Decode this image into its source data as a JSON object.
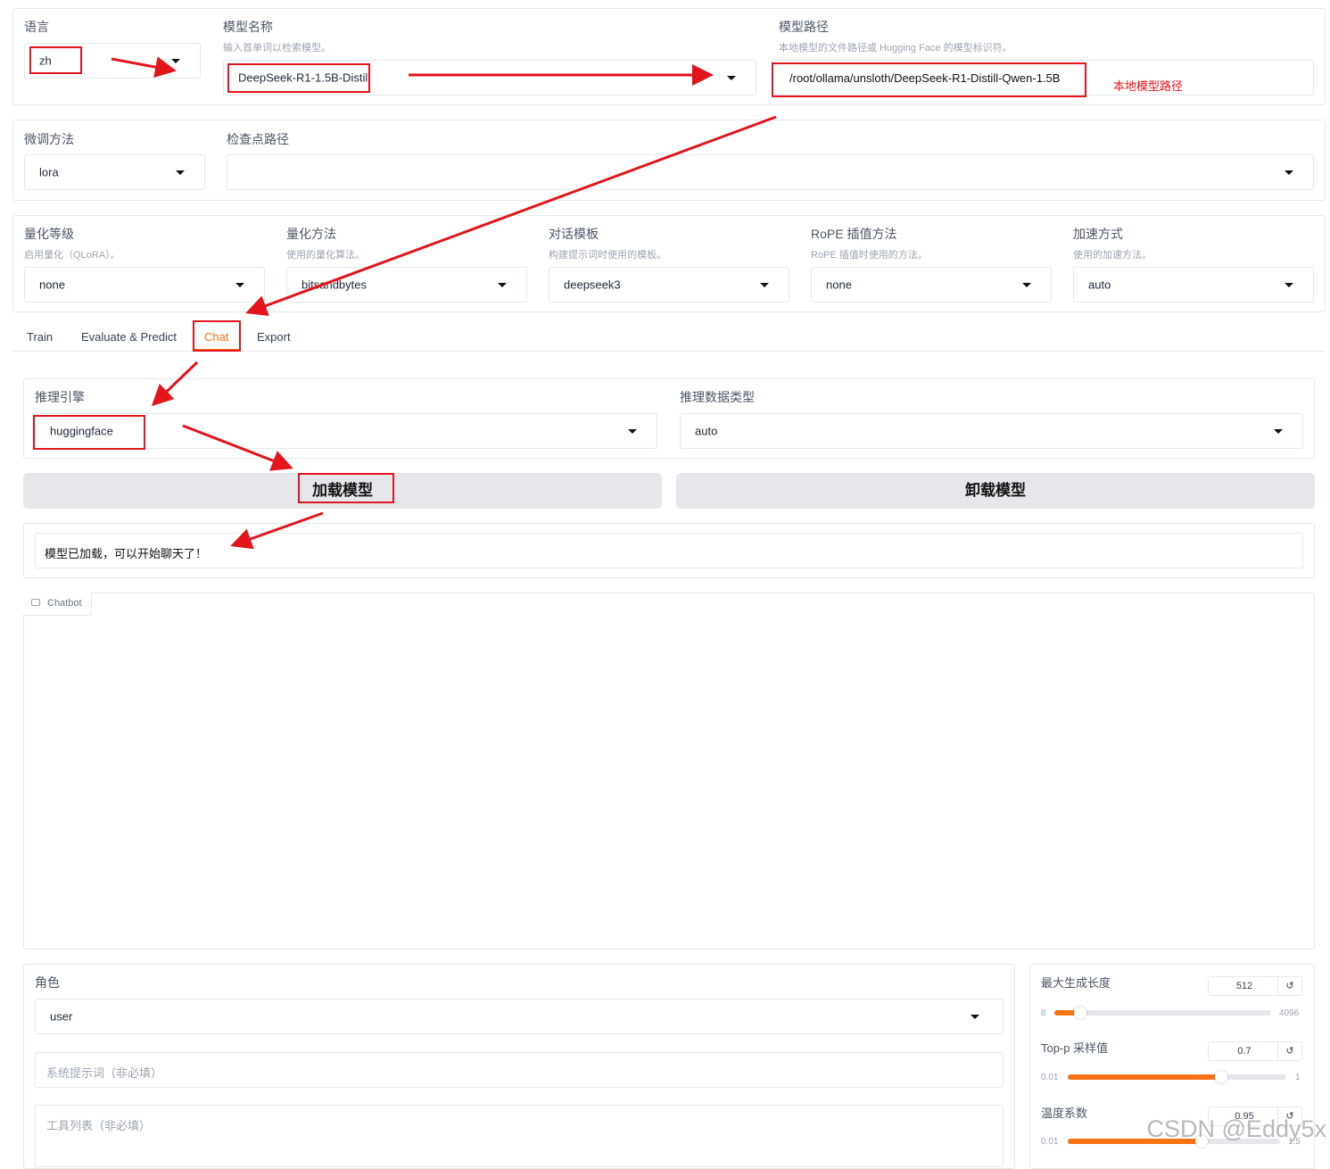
{
  "row1": {
    "lang": {
      "label": "语言",
      "value": "zh"
    },
    "model_name": {
      "label": "模型名称",
      "hint": "输入首单词以检索模型。",
      "value": "DeepSeek-R1-1.5B-Distill"
    },
    "model_path": {
      "label": "模型路径",
      "hint": "本地模型的文件路径或 Hugging Face 的模型标识符。",
      "value": "/root/ollama/unsloth/DeepSeek-R1-Distill-Qwen-1.5B",
      "annotation": "本地模型路径"
    }
  },
  "row2": {
    "finetune": {
      "label": "微调方法",
      "value": "lora"
    },
    "checkpoint": {
      "label": "检查点路径",
      "value": ""
    }
  },
  "row3": {
    "quant_bit": {
      "label": "量化等级",
      "hint": "启用量化（QLoRA）。",
      "value": "none"
    },
    "quant_method": {
      "label": "量化方法",
      "hint": "使用的量化算法。",
      "value": "bitsandbytes"
    },
    "template": {
      "label": "对话模板",
      "hint": "构建提示词时使用的模板。",
      "value": "deepseek3"
    },
    "rope": {
      "label": "RoPE 插值方法",
      "hint": "RoPE 插值时使用的方法。",
      "value": "none"
    },
    "booster": {
      "label": "加速方式",
      "hint": "使用的加速方法。",
      "value": "auto"
    }
  },
  "tabs": [
    "Train",
    "Evaluate & Predict",
    "Chat",
    "Export"
  ],
  "active_tab": "Chat",
  "chat": {
    "infer_backend": {
      "label": "推理引擎",
      "value": "huggingface"
    },
    "infer_dtype": {
      "label": "推理数据类型",
      "value": "auto"
    },
    "load_btn": "加载模型",
    "unload_btn": "卸载模型",
    "info": "模型已加载，可以开始聊天了！",
    "chatbot_label": "Chatbot",
    "role": {
      "label": "角色",
      "value": "user"
    },
    "system_ph": "系统提示词（非必填）",
    "tools_ph": "工具列表（非必填）"
  },
  "sliders": [
    {
      "label": "最大生成长度",
      "value": "512",
      "min": "8",
      "max": "4096",
      "fraction": 0.12
    },
    {
      "label": "Top-p 采样值",
      "value": "0.7",
      "min": "0.01",
      "max": "1",
      "fraction": 0.7
    },
    {
      "label": "温度系数",
      "value": "0.95",
      "min": "0.01",
      "max": "1.5",
      "fraction": 0.63
    }
  ],
  "reset_icon": "↺",
  "watermark": "CSDN @Eddy5x",
  "colors": {
    "accent": "#f97316",
    "annotation_red": "#e3141b"
  }
}
